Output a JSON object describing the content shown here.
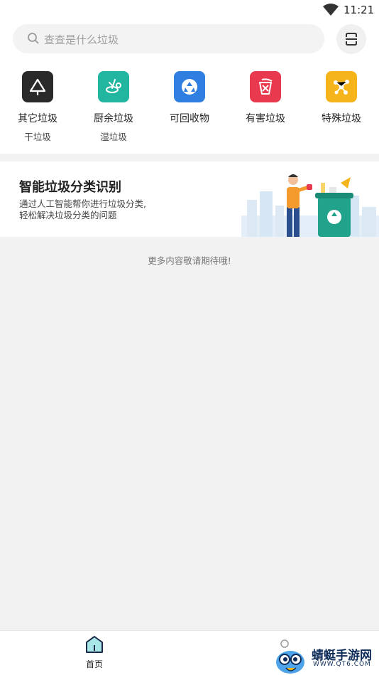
{
  "status_bar": {
    "time": "11:21",
    "wifi_icon": "wifi-icon"
  },
  "search": {
    "placeholder": "查查是什么垃圾",
    "icon": "search-icon",
    "scan_icon": "scan-icon"
  },
  "categories": [
    {
      "name": "其它垃圾",
      "sub": "干垃圾",
      "color": "#2a2a2a",
      "icon": "recycle-triangle-icon"
    },
    {
      "name": "厨余垃圾",
      "sub": "湿垃圾",
      "color": "#22b5a0",
      "icon": "food-waste-icon"
    },
    {
      "name": "可回收物",
      "sub": "",
      "color": "#2f7fe0",
      "icon": "recycle-icon"
    },
    {
      "name": "有害垃圾",
      "sub": "",
      "color": "#e8394f",
      "icon": "hazard-icon"
    },
    {
      "name": "特殊垃圾",
      "sub": "",
      "color": "#f5b419",
      "icon": "molecule-icon"
    }
  ],
  "banner": {
    "title": "智能垃圾分类识别",
    "desc_line1": "通过人工智能帮你进行垃圾分类,",
    "desc_line2": "轻松解决垃圾分类的问题",
    "art": "person-throwing-trash-illustration"
  },
  "more_text": "更多内容敬请期待哦!",
  "tabbar": {
    "home_label": "首页",
    "home_icon": "home-icon"
  },
  "watermark": {
    "text": "蜻蜓手游网",
    "url": "WWW.QT6.COM",
    "logo": "mascot-logo"
  }
}
